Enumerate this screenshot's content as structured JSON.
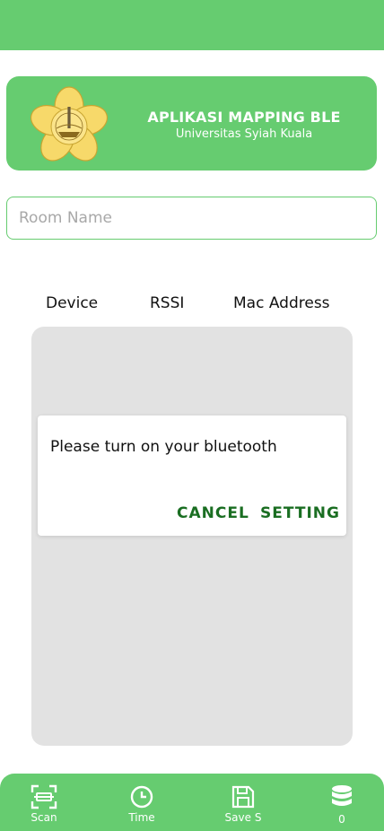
{
  "header": {
    "title": "APLIKASI MAPPING BLE",
    "subtitle": "Universitas Syiah Kuala",
    "logo_text": "UNIVERSITAS SYIAH KUALA"
  },
  "room_input": {
    "placeholder": "Room Name",
    "value": ""
  },
  "columns": {
    "device": "Device",
    "rssi": "RSSI",
    "mac": "Mac Address"
  },
  "dialog": {
    "message": "Please turn on your bluetooth",
    "cancel_label": "CANCEL",
    "setting_label": "SETTING"
  },
  "nav": {
    "scan_label": "Scan",
    "time_label": "Time",
    "save_label": "Save S",
    "count_label": "0"
  },
  "colors": {
    "primary": "#66cc70",
    "action": "#1a6e22",
    "panel": "#e2e2e2"
  }
}
